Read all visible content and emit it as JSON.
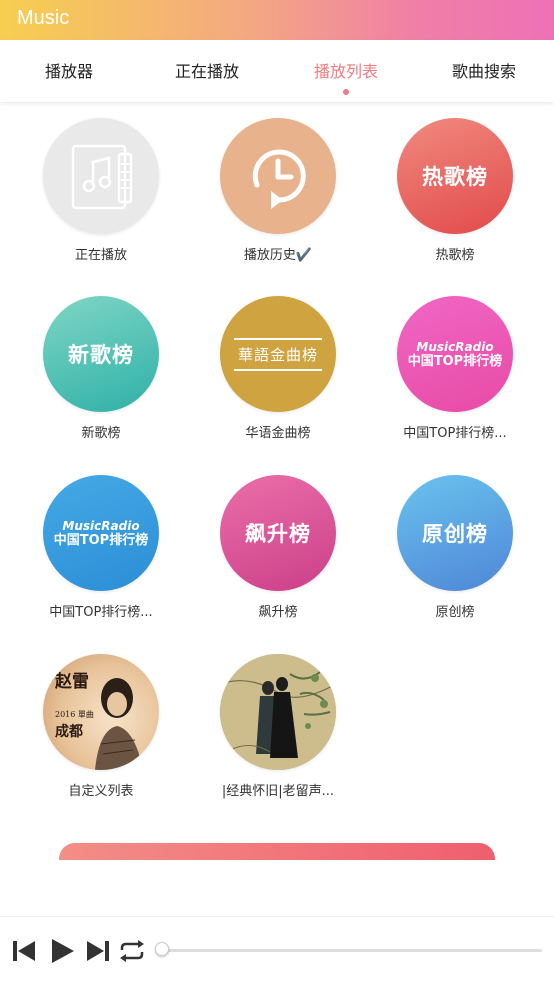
{
  "app": {
    "title": "Music"
  },
  "tabs": [
    {
      "label": "播放器"
    },
    {
      "label": "正在播放"
    },
    {
      "label": "播放列表",
      "active": true
    },
    {
      "label": "歌曲搜索"
    }
  ],
  "colors": {
    "accent": "#f07a82"
  },
  "playlists": [
    {
      "caption": "正在播放",
      "icon": "music-document-icon"
    },
    {
      "caption": "播放历史✔️",
      "icon": "clock-history-icon"
    },
    {
      "caption": "热歌榜",
      "cover_text": "热歌榜"
    },
    {
      "caption": "新歌榜",
      "cover_text": "新歌榜"
    },
    {
      "caption": "华语金曲榜",
      "cover_text": "華語金曲榜"
    },
    {
      "caption": "中国TOP排行榜...",
      "cover_text_top": "MusicRadio",
      "cover_text_bottom": "中国TOP排行榜"
    },
    {
      "caption": "中国TOP排行榜...",
      "cover_text_top": "MusicRadio",
      "cover_text_bottom": "中国TOP排行榜"
    },
    {
      "caption": "飙升榜",
      "cover_text": "飙升榜"
    },
    {
      "caption": "原创榜",
      "cover_text": "原创榜"
    },
    {
      "caption": "自定义列表",
      "cover_text_top": "赵雷",
      "cover_text_year": "2016 單曲",
      "cover_text_bottom": "成都"
    },
    {
      "caption": "|经典怀旧|老留声...",
      "icon": "vintage-painting-icon"
    }
  ],
  "player": {
    "controls": [
      "previous-icon",
      "play-icon",
      "next-icon",
      "repeat-icon"
    ],
    "progress": 0
  }
}
